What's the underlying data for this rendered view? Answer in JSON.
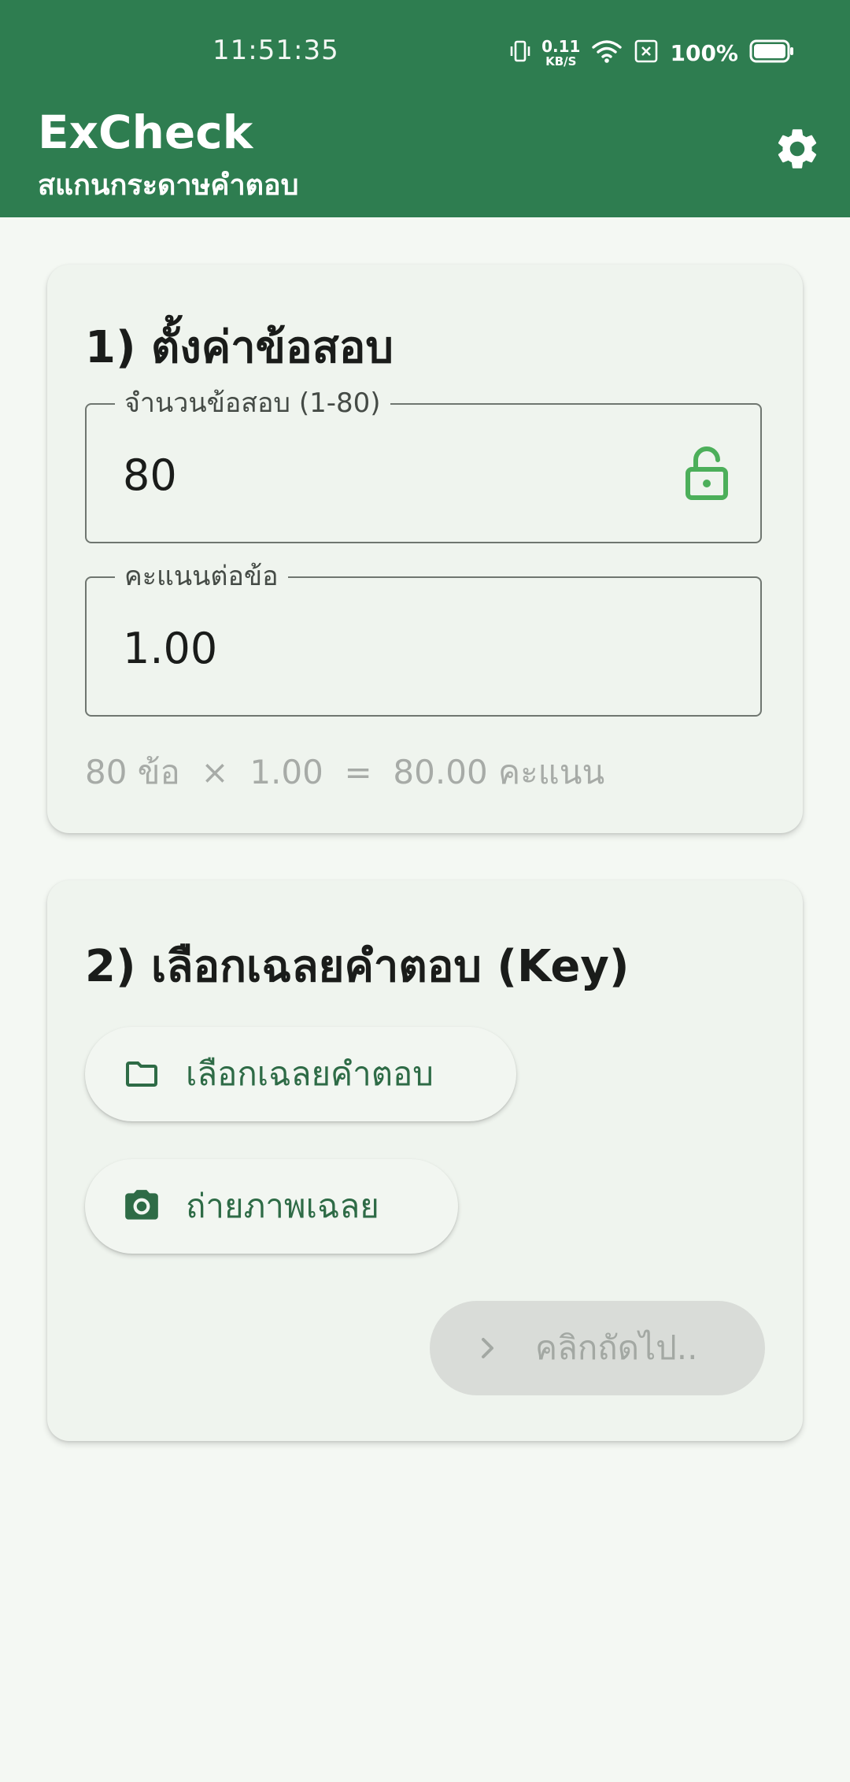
{
  "status_bar": {
    "time": "11:51:35",
    "net_speed_value": "0.11",
    "net_speed_unit": "KB/S",
    "battery_percent": "100%"
  },
  "app_bar": {
    "title": "ExCheck",
    "subtitle": "สแกนกระดาษคำตอบ",
    "settings_icon": "gear-icon"
  },
  "colors": {
    "primary": "#2e7d50",
    "background": "#f4f8f3",
    "card": "#eff4ee",
    "lock_icon": "#4caf5a",
    "disabled_button": "#d9dcd8"
  },
  "settings_card": {
    "title": "1) ตั้งค่าข้อสอบ",
    "question_count": {
      "label": "จำนวนข้อสอบ (1-80)",
      "value": "80",
      "trailing_icon": "lock-open-icon"
    },
    "points_per_question": {
      "label": "คะแนนต่อข้อ",
      "value": "1.00"
    },
    "calculation": "80 ข้อ  ×  1.00  =  80.00 คะแนน"
  },
  "key_card": {
    "title": "2) เลือกเฉลยคำตอบ (Key)",
    "select_key_button": {
      "label": "เลือกเฉลยคำตอบ",
      "icon": "folder-icon"
    },
    "photo_key_button": {
      "label": "ถ่ายภาพเฉลย",
      "icon": "camera-icon"
    },
    "next_button": {
      "label": "คลิกถัดไป..",
      "icon": "chevron-right-icon"
    }
  }
}
